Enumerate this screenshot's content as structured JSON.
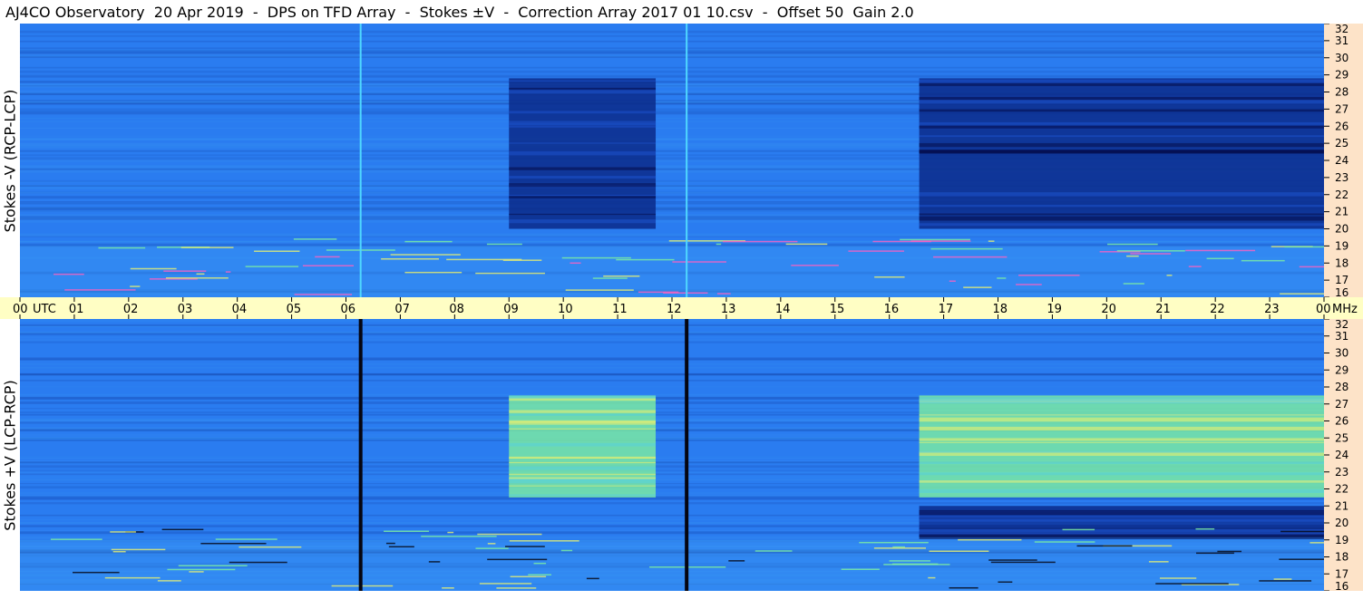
{
  "title": "AJ4CO Observatory  20 Apr 2019  -  DPS on TFD Array  -  Stokes ±V  -  Correction Array 2017 01 10.csv  -  Offset 50  Gain 2.0",
  "chart_data": {
    "type": "heatmap",
    "panels": [
      {
        "id": "top",
        "ylabel": "Stokes -V (RCP-LCP)",
        "base_color": "#2a7cf0",
        "bands": [
          {
            "start": 9.0,
            "end": 11.7,
            "freq_low": 20.0,
            "freq_high": 28.8,
            "level": "dark"
          },
          {
            "start": 16.55,
            "end": 24.0,
            "freq_low": 20.0,
            "freq_high": 28.8,
            "level": "dark"
          }
        ],
        "interference_lines_utc": [
          6.27,
          12.27
        ],
        "interference_style": "bright"
      },
      {
        "id": "bottom",
        "ylabel": "Stokes +V (LCP-RCP)",
        "base_color": "#2a7cf0",
        "bands": [
          {
            "start": 9.0,
            "end": 11.7,
            "freq_low": 21.5,
            "freq_high": 27.5,
            "level": "bright"
          },
          {
            "start": 16.55,
            "end": 24.0,
            "freq_low": 21.5,
            "freq_high": 27.5,
            "level": "bright"
          },
          {
            "start": 16.55,
            "end": 24.0,
            "freq_low": 19.2,
            "freq_high": 21.0,
            "level": "dark"
          }
        ],
        "interference_lines_utc": [
          6.27,
          12.27
        ],
        "interference_style": "dark"
      }
    ],
    "time_axis": {
      "range": [
        0,
        24
      ],
      "tick_labels": [
        "00",
        "01",
        "02",
        "03",
        "04",
        "05",
        "06",
        "07",
        "08",
        "09",
        "10",
        "11",
        "12",
        "13",
        "14",
        "15",
        "16",
        "17",
        "18",
        "19",
        "20",
        "21",
        "22",
        "23",
        "00"
      ],
      "start_suffix": "UTC",
      "end_suffix": "MHz"
    },
    "freq_axis": {
      "range": [
        16,
        32
      ],
      "tick_labels": [
        "16",
        "17",
        "18",
        "19",
        "20",
        "21",
        "22",
        "23",
        "24",
        "25",
        "26",
        "27",
        "28",
        "29",
        "30",
        "31",
        "32"
      ]
    },
    "colors": {
      "dark": "#0a2a8a",
      "base": "#2a7cf0",
      "mid": "#3fa0f5",
      "bright": "#7ef0a0",
      "hot": "#e8f070",
      "black": "#050510",
      "axis_time_bg": "#fffec4",
      "axis_freq_bg": "#fde3c8"
    }
  }
}
